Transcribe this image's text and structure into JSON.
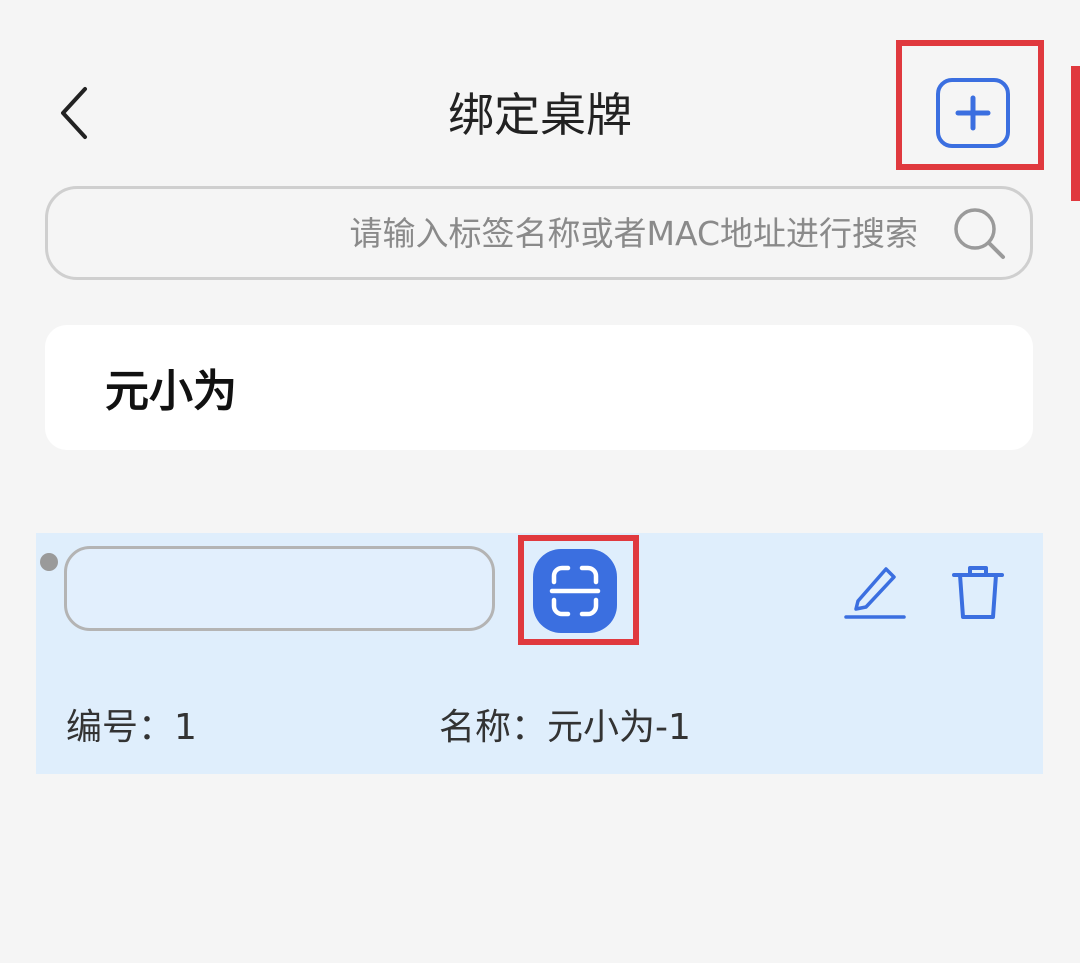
{
  "header": {
    "title": "绑定桌牌",
    "back_icon": "chevron-left-icon",
    "add_icon": "plus-square-icon"
  },
  "search": {
    "placeholder": "请输入标签名称或者MAC地址进行搜索",
    "value": "",
    "icon": "search-icon"
  },
  "group": {
    "name": "元小为"
  },
  "tags": [
    {
      "mac_value": "",
      "scan_icon": "scan-icon",
      "edit_icon": "edit-icon",
      "delete_icon": "trash-icon",
      "number_label": "编号：",
      "number_value": "1",
      "name_label": "名称：",
      "name_value": "元小为-1"
    }
  ],
  "colors": {
    "accent": "#3b6fe0",
    "highlight": "#e0393e",
    "row_background": "#dfeefc",
    "page_background": "#f5f5f5"
  }
}
